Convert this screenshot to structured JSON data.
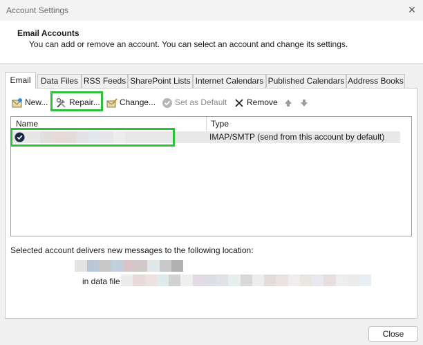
{
  "window": {
    "title": "Account Settings"
  },
  "header": {
    "title": "Email Accounts",
    "description": "You can add or remove an account. You can select an account and change its settings."
  },
  "tabs": [
    {
      "label": "Email",
      "active": true
    },
    {
      "label": "Data Files"
    },
    {
      "label": "RSS Feeds"
    },
    {
      "label": "SharePoint Lists"
    },
    {
      "label": "Internet Calendars"
    },
    {
      "label": "Published Calendars"
    },
    {
      "label": "Address Books"
    }
  ],
  "toolbar": {
    "new_label": "New...",
    "repair_label": "Repair...",
    "change_label": "Change...",
    "set_default_label": "Set as Default",
    "remove_label": "Remove"
  },
  "accounts_table": {
    "columns": [
      "Name",
      "Type"
    ],
    "rows": [
      {
        "type": "IMAP/SMTP (send from this account by default)",
        "default": true
      }
    ]
  },
  "delivery": {
    "label": "Selected account delivers new messages to the following location:",
    "in_data_file_label": "in data file"
  },
  "footer": {
    "close_label": "Close"
  },
  "colors": {
    "highlight": "#2fbf3a",
    "selected_row": "#e8e8e8"
  }
}
